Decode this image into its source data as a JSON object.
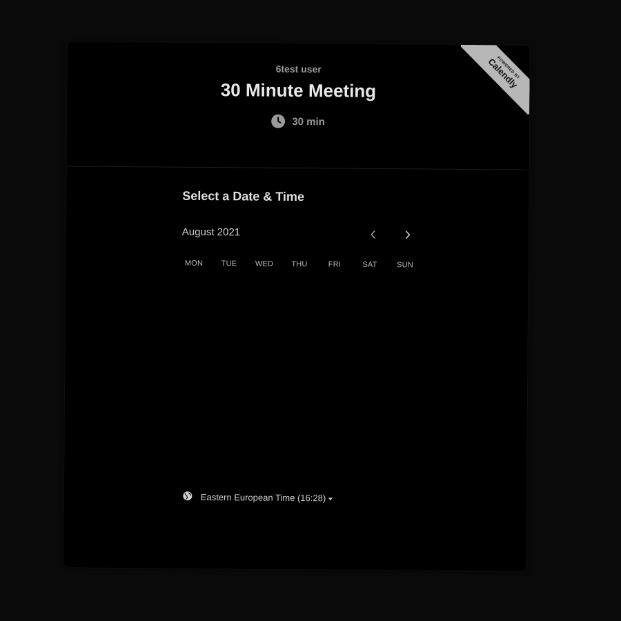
{
  "header": {
    "host_name": "6test user",
    "event_title": "30 Minute Meeting",
    "duration": "30 min",
    "icon": "clock-icon"
  },
  "badge": {
    "powered_by": "POWERED BY",
    "brand": "Calendly"
  },
  "calendar": {
    "section_title": "Select a Date & Time",
    "month_label": "August 2021",
    "prev_icon": "chevron-left-icon",
    "next_icon": "chevron-right-icon",
    "weekdays": [
      "MON",
      "TUE",
      "WED",
      "THU",
      "FRI",
      "SAT",
      "SUN"
    ]
  },
  "timezone": {
    "icon": "globe-icon",
    "label": "Eastern European Time (16:28)"
  },
  "colors": {
    "background": "#0a0a0a",
    "card": "#000000",
    "ribbon": "#b7b7b7"
  }
}
